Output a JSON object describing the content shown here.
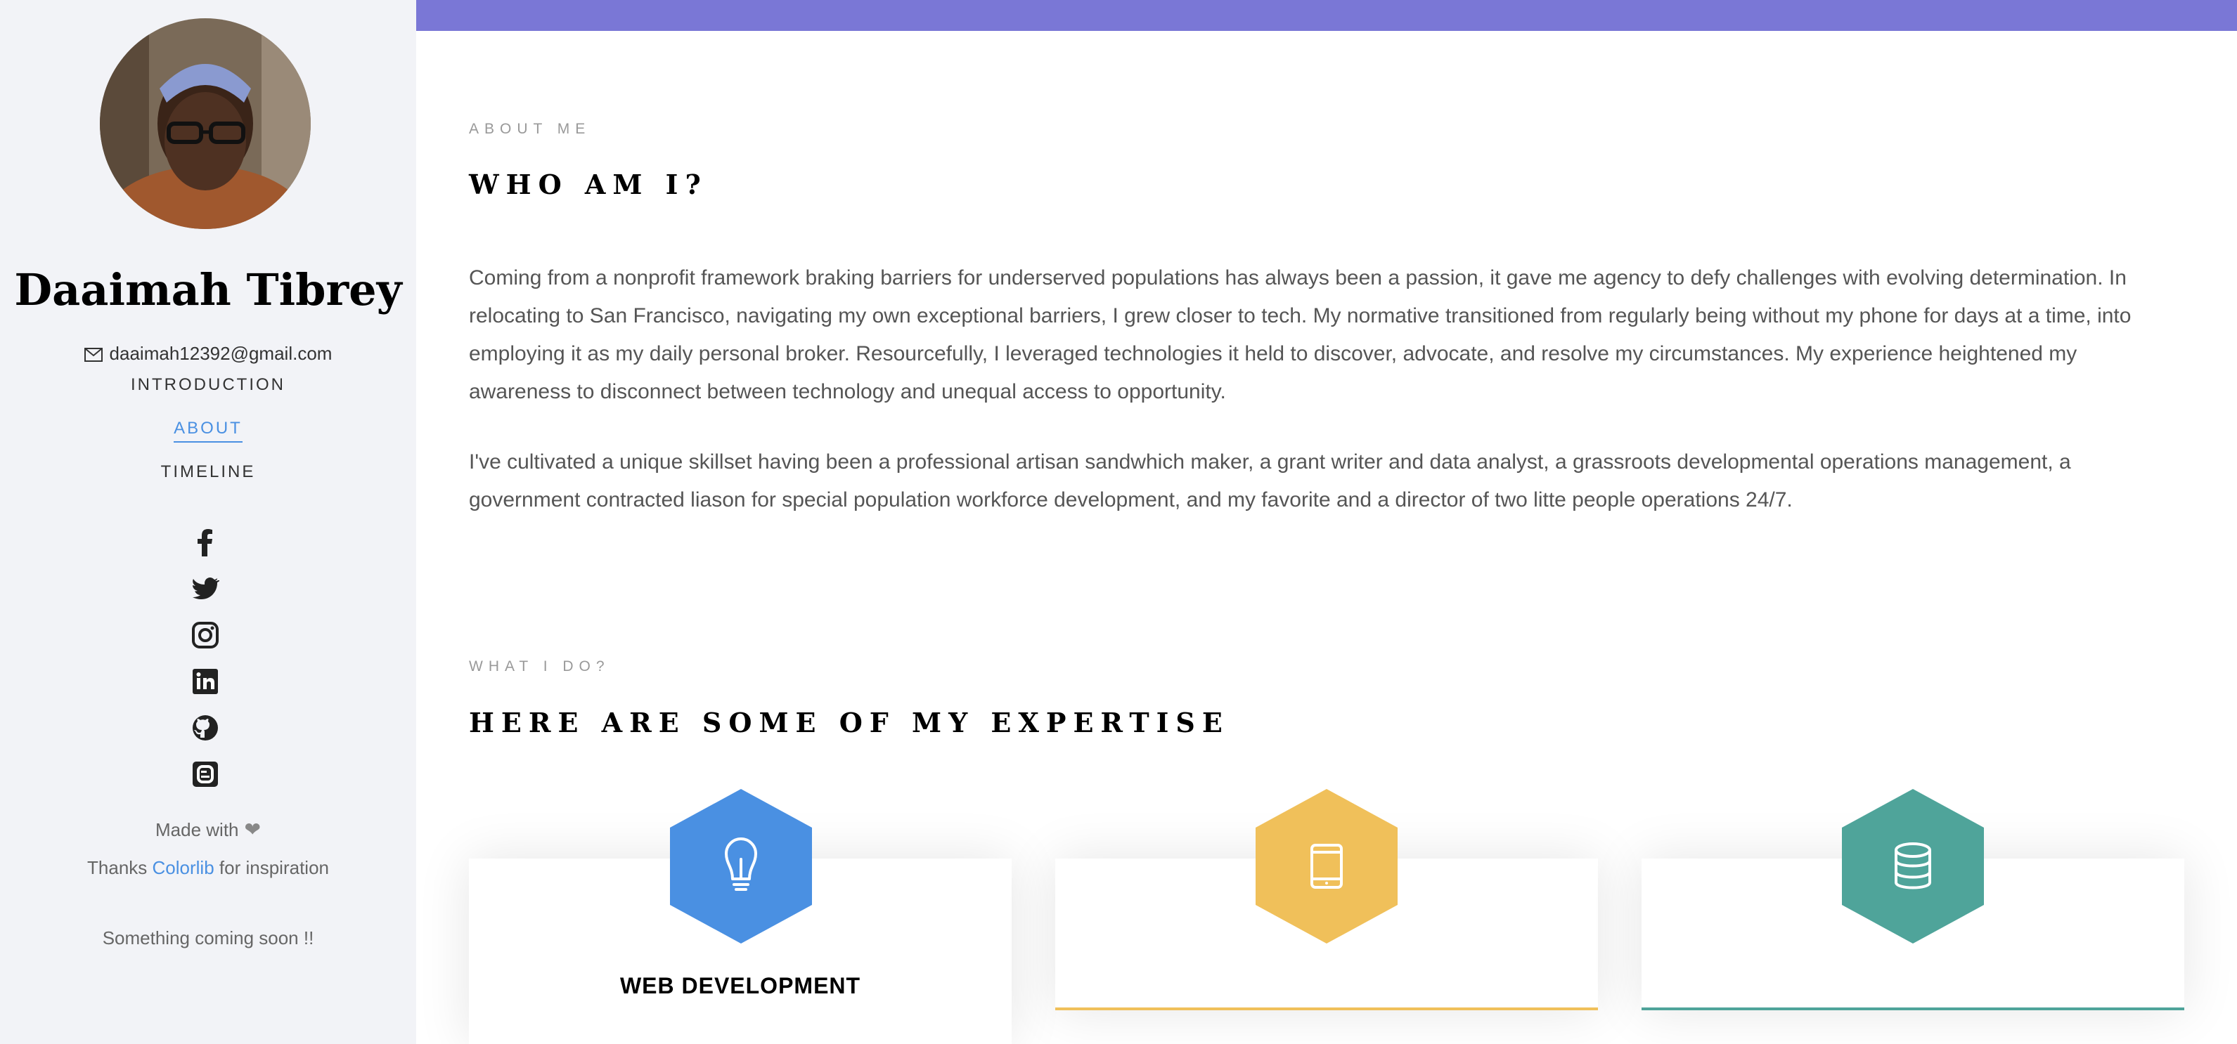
{
  "sidebar": {
    "name": "Daaimah Tibrey",
    "email": "daaimah12392@gmail.com",
    "nav": [
      {
        "label": "INTRODUCTION",
        "active": false
      },
      {
        "label": "ABOUT",
        "active": true
      },
      {
        "label": "TIMELINE",
        "active": false
      }
    ],
    "social_icons": [
      "facebook-icon",
      "twitter-icon",
      "instagram-icon",
      "linkedin-icon",
      "github-icon",
      "blogger-icon"
    ],
    "made_with": "Made with",
    "thanks_prefix": "Thanks",
    "thanks_link": "Colorlib",
    "thanks_suffix": "for inspiration",
    "coming_soon": "Something coming soon !!"
  },
  "about": {
    "eyebrow": "ABOUT ME",
    "heading": "WHO AM I?",
    "paragraph_1": "Coming from a nonprofit framework braking barriers for underserved populations has always been a passion, it gave me agency to defy challenges with evolving determination. In relocating to San Francisco, navigating my own exceptional barriers, I grew closer to tech. My normative transitioned from regularly being without my phone for days at a time, into employing it as my daily personal broker. Resourcefully, I leveraged technologies it held to discover, advocate, and resolve my circumstances. My experience heightened my awareness to disconnect between technology and unequal access to opportunity.",
    "paragraph_2": "I've cultivated a unique skillset having been a professional artisan sandwhich maker, a grant writer and data analyst, a grassroots developmental operations management, a government contracted liason for special population workforce development, and my favorite and a director of two litte people operations 24/7."
  },
  "expertise": {
    "eyebrow": "WHAT I DO?",
    "heading": "HERE ARE SOME OF MY EXPERTISE",
    "cards": [
      {
        "title": "WEB DEVELOPMENT",
        "icon": "lightbulb-icon",
        "color": "#4a90e2"
      },
      {
        "title": "",
        "icon": "mobile-icon",
        "color": "#f0c05a"
      },
      {
        "title": "",
        "icon": "database-icon",
        "color": "#4fa49a"
      }
    ]
  },
  "colors": {
    "topbar": "#7a77d6",
    "sidebar_bg": "#f2f3f7",
    "link": "#4a90e2"
  }
}
